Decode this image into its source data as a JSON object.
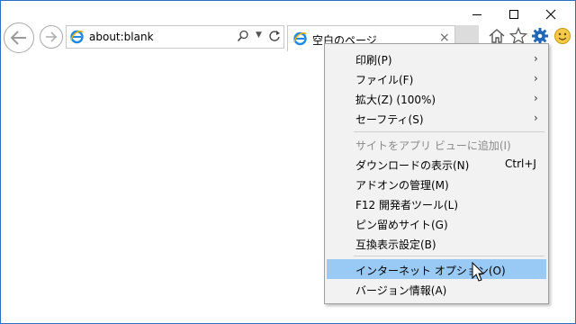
{
  "window": {
    "controls": {
      "minimize_icon": "minimize-icon",
      "maximize_icon": "maximize-icon",
      "close_icon": "close-icon"
    },
    "accent_color": "#2b6fc4"
  },
  "toolbar": {
    "back_icon": "back-arrow-icon",
    "forward_icon": "forward-arrow-icon",
    "address": {
      "value": "about:blank",
      "search_icon": "search-icon",
      "dropdown_icon": "chevron-down-icon",
      "refresh_icon": "refresh-icon"
    },
    "tab": {
      "title": "空白のページ",
      "close_label": "×"
    },
    "icons": [
      "home-icon",
      "star-icon",
      "gear-icon",
      "smiley-icon"
    ]
  },
  "menu": {
    "highlight_color": "#99c9f5",
    "items": [
      {
        "label": "印刷(P)",
        "arrow": "›"
      },
      {
        "label": "ファイル(F)",
        "arrow": "›"
      },
      {
        "label": "拡大(Z) (100%)",
        "arrow": "›"
      },
      {
        "label": "セーフティ(S)",
        "arrow": "›"
      },
      {
        "label": "サイトをアプリ ビューに追加(I)",
        "disabled": true
      },
      {
        "label": "ダウンロードの表示(N)",
        "shortcut": "Ctrl+J"
      },
      {
        "label": "アドオンの管理(M)"
      },
      {
        "label": "F12 開発者ツール(L)"
      },
      {
        "label": "ピン留めサイト(G)"
      },
      {
        "label": "互換表示設定(B)"
      },
      {
        "label": "インターネット オプション(O)",
        "highlighted": true
      },
      {
        "label": "バージョン情報(A)"
      }
    ]
  }
}
